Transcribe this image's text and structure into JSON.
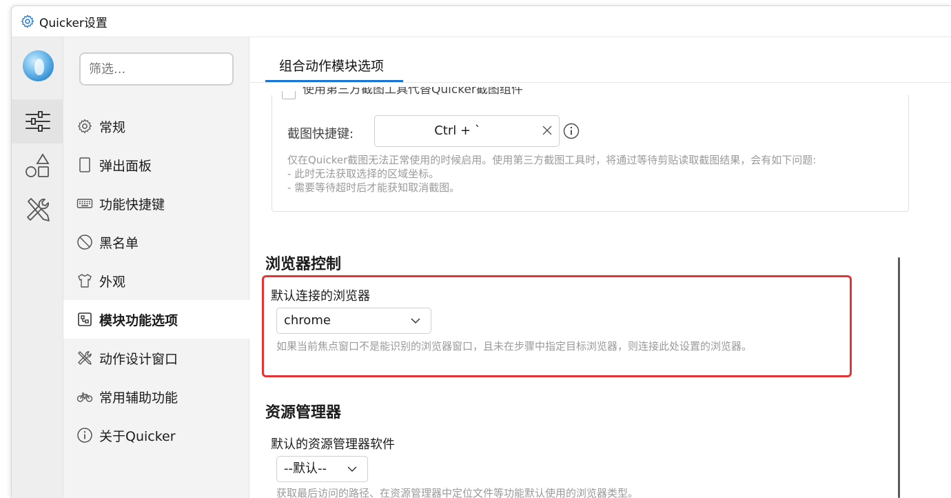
{
  "window": {
    "title": "Quicker设置"
  },
  "rail": {
    "items": [
      {
        "icon": "sliders-icon",
        "active": true
      },
      {
        "icon": "shapes-icon",
        "active": false
      },
      {
        "icon": "tools-icon",
        "active": false
      }
    ]
  },
  "nav": {
    "filter_placeholder": "筛选...",
    "items": [
      {
        "label": "常规",
        "icon": "gear-icon"
      },
      {
        "label": "弹出面板",
        "icon": "panel-icon"
      },
      {
        "label": "功能快捷键",
        "icon": "keyboard-icon"
      },
      {
        "label": "黑名单",
        "icon": "ban-icon"
      },
      {
        "label": "外观",
        "icon": "shirt-icon"
      },
      {
        "label": "模块功能选项",
        "icon": "module-icon",
        "active": true
      },
      {
        "label": "动作设计窗口",
        "icon": "design-tools-icon"
      },
      {
        "label": "常用辅助功能",
        "icon": "bicycle-icon"
      },
      {
        "label": "关于Quicker",
        "icon": "info-icon"
      }
    ]
  },
  "content": {
    "tab_label": "组合动作模块选项",
    "screenshot": {
      "clipped_checkbox_label": "使用第三方截图工具代替Quicker截图组件",
      "hotkey_label": "截图快捷键:",
      "hotkey_value": "Ctrl + `",
      "desc_lines": [
        "仅在Quicker截图无法正常使用的时候启用。使用第三方截图工具时，将通过等待剪贴读取截图结果，会有如下问题:",
        "- 此时无法获取选择的区域坐标。",
        "- 需要等待超时后才能获知取消截图。"
      ]
    },
    "browser": {
      "section_title": "浏览器控制",
      "field_label": "默认连接的浏览器",
      "selected": "chrome",
      "desc": "如果当前焦点窗口不是能识别的浏览器窗口，且未在步骤中指定目标浏览器，则连接此处设置的浏览器。"
    },
    "explorer": {
      "section_title": "资源管理器",
      "field_label": "默认的资源管理器软件",
      "selected": "--默认--",
      "desc": "获取最后访问的路径、在资源管理器中定位文件等功能默认使用的浏览器类型。"
    }
  },
  "colors": {
    "accent": "#1a74d4",
    "highlight": "#e23434"
  }
}
